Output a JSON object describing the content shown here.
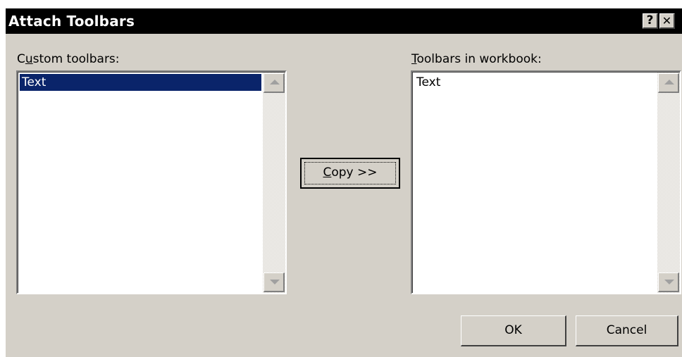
{
  "dialog": {
    "title": "Attach Toolbars",
    "help_glyph": "?",
    "close_glyph": "✕"
  },
  "custom_toolbars": {
    "label_prefix": "C",
    "label_mnemonic": "u",
    "label_rest": "stom toolbars:",
    "items": [
      {
        "label": "Text",
        "selected": true
      }
    ]
  },
  "workbook_toolbars": {
    "label_mnemonic": "T",
    "label_rest": "oolbars in workbook:",
    "items": [
      {
        "label": "Text",
        "selected": false
      }
    ]
  },
  "buttons": {
    "copy_mnemonic": "C",
    "copy_rest": "opy >>",
    "ok": "OK",
    "cancel": "Cancel"
  },
  "colors": {
    "title_bar": "#000000",
    "dialog_bg": "#d4d0c8",
    "selection": "#0a246a"
  }
}
